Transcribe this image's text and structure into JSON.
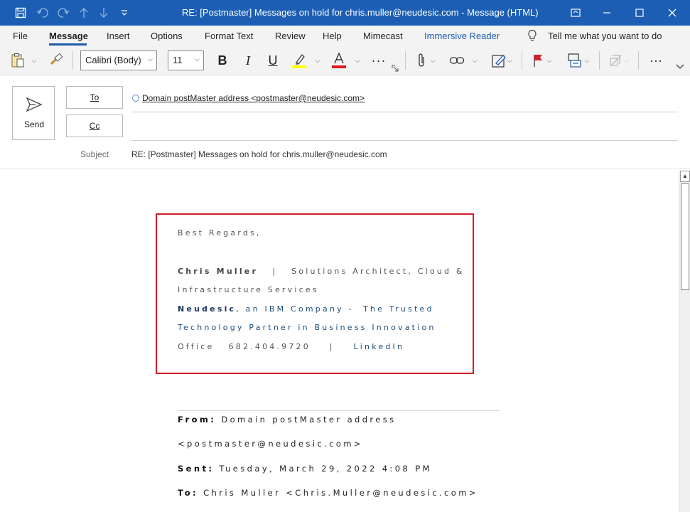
{
  "window": {
    "title": "RE: [Postmaster] Messages on hold for chris.muller@neudesic.com  -  Message (HTML)"
  },
  "menu": {
    "items": [
      "File",
      "Message",
      "Insert",
      "Options",
      "Format Text",
      "Review",
      "Help",
      "Mimecast",
      "Immersive Reader"
    ],
    "active": "Message",
    "tell_me": "Tell me what you want to do"
  },
  "ribbon": {
    "font_name": "Calibri (Body)",
    "font_size": "11",
    "bold": "B",
    "italic": "I",
    "underline": "U",
    "more": "···",
    "highlight_color": "#ffff00",
    "font_color": "#e01b24"
  },
  "compose": {
    "send_label": "Send",
    "to_label": "To",
    "cc_label": "Cc",
    "to_value": "Domain postMaster address <postmaster@neudesic.com>",
    "cc_value": "",
    "subject_label": "Subject",
    "subject_value": "RE: [Postmaster] Messages on hold for chris.muller@neudesic.com"
  },
  "signature": {
    "greeting": "Best Regards,",
    "name": "Chris Muller",
    "separator": "|",
    "title_line1": "Solutions Architect, Cloud &",
    "title_line2": "Infrastructure Services",
    "company": "Neudesic",
    "company_suffix": ", an IBM Company -",
    "tagline1": "The Trusted",
    "tagline2": "Technology Partner in Business Innovation",
    "office_label": "Office",
    "office_phone": "682.404.9720",
    "office_sep": "|",
    "linkedin": "LinkedIn"
  },
  "quoted": {
    "from_label": "From:",
    "from_value": "Domain postMaster address",
    "from_value2": "<postmaster@neudesic.com>",
    "sent_label": "Sent:",
    "sent_value": "Tuesday, March 29, 2022 4:08 PM",
    "to_label": "To:",
    "to_value": "Chris Muller <Chris.Muller@neudesic.com>"
  },
  "colors": {
    "titlebar": "#1b5eb3",
    "accent": "#1e5aa8",
    "highlight_box": "#d0202a"
  }
}
